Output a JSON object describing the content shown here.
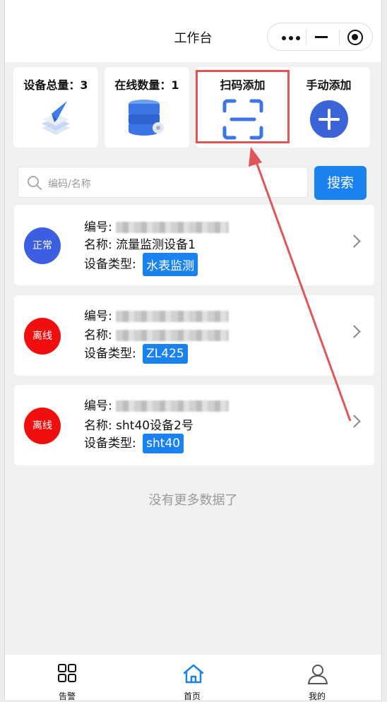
{
  "header": {
    "title": "工作台"
  },
  "stats": [
    {
      "label": "设备总量：3",
      "icon": "paper-plane-layers-icon"
    },
    {
      "label": "在线数量：1",
      "icon": "database-gear-icon"
    },
    {
      "label": "扫码添加",
      "icon": "scan-icon"
    },
    {
      "label": "手动添加",
      "icon": "plus-circle-icon"
    }
  ],
  "search": {
    "placeholder": "编码/名称",
    "button": "搜索"
  },
  "devices": [
    {
      "status": "正常",
      "status_color": "#3b5fe0",
      "code_label": "编号:",
      "name_label": "名称:",
      "name": "流量监测设备1",
      "type_label": "设备类型:",
      "type": "水表监测"
    },
    {
      "status": "离线",
      "status_color": "#f00f0f",
      "code_label": "编号:",
      "name_label": "名称:",
      "name": "",
      "type_label": "设备类型:",
      "type": "ZL425"
    },
    {
      "status": "离线",
      "status_color": "#f00f0f",
      "code_label": "编号:",
      "name_label": "名称:",
      "name": "sht40设备2号",
      "type_label": "设备类型:",
      "type": "sht40"
    }
  ],
  "list_end": "没有更多数据了",
  "tabbar": [
    {
      "label": "告警",
      "icon": "grid-icon"
    },
    {
      "label": "首页",
      "icon": "home-icon",
      "active": true
    },
    {
      "label": "我的",
      "icon": "user-icon"
    }
  ],
  "colors": {
    "primary": "#1a82ef",
    "annotation": "#e05557"
  }
}
